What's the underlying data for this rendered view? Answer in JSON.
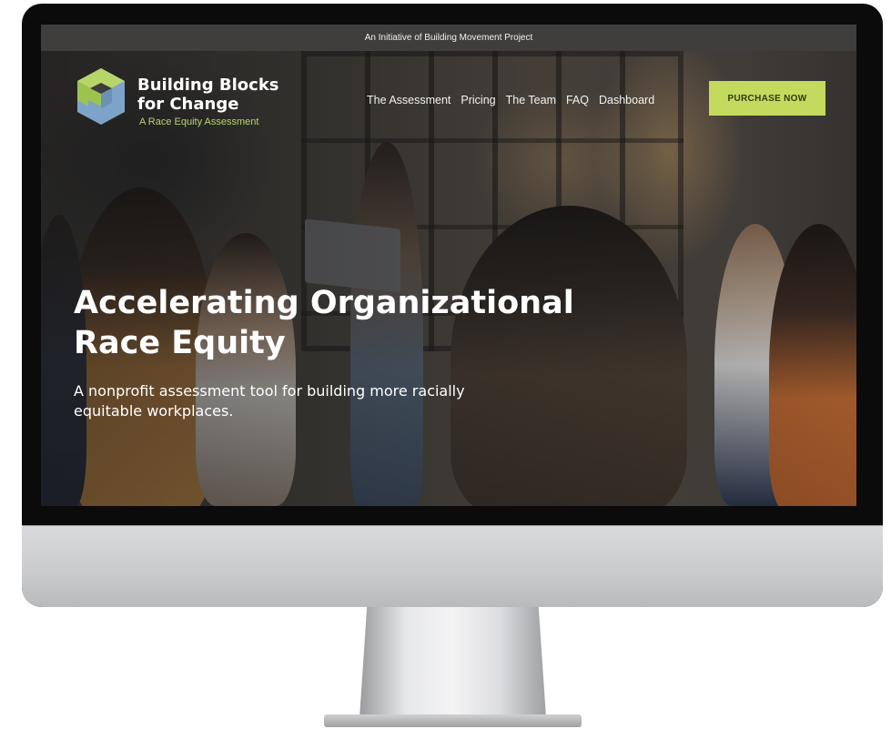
{
  "topbar": {
    "text": "An Initiative of Building Movement Project"
  },
  "logo": {
    "line1": "Building Blocks",
    "line2": "for Change",
    "tagline": "A Race Equity Assessment"
  },
  "nav": {
    "items": [
      "The Assessment",
      "Pricing",
      "The Team",
      "FAQ",
      "Dashboard"
    ]
  },
  "cta": {
    "label": "PURCHASE NOW"
  },
  "hero": {
    "headline_line1": "Accelerating Organizational",
    "headline_line2": "Race Equity",
    "subtext": "A nonprofit assessment tool for building more racially equitable workplaces."
  },
  "colors": {
    "accent_green": "#c4da5e",
    "logo_green": "#b7d56a",
    "logo_blue": "#7ea3c8",
    "topbar_bg": "#3f3e3c"
  }
}
